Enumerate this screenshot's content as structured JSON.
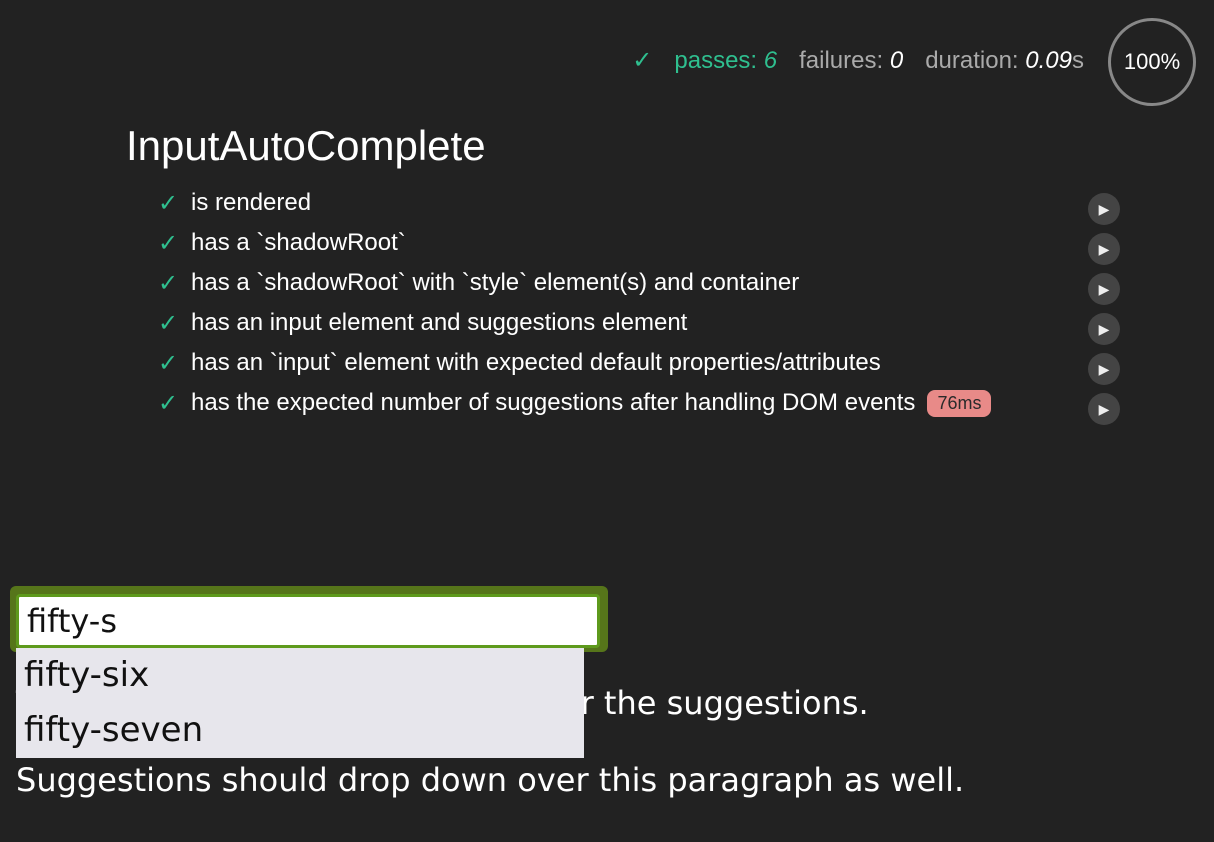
{
  "stats": {
    "check_glyph": "✓",
    "passes_label": "passes:",
    "passes_value": "6",
    "failures_label": "failures:",
    "failures_value": "0",
    "duration_label": "duration:",
    "duration_value": "0.09",
    "duration_unit": "s",
    "progress_text": "100%"
  },
  "suite": {
    "title": "InputAutoComplete",
    "tests": [
      {
        "label": "is rendered",
        "status": "passed"
      },
      {
        "label": "has a `shadowRoot`",
        "status": "passed"
      },
      {
        "label": "has a `shadowRoot` with `style` element(s) and container",
        "status": "passed"
      },
      {
        "label": "has an input element and suggestions element",
        "status": "passed"
      },
      {
        "label": "has an `input` element with expected default properties/attributes",
        "status": "passed"
      },
      {
        "label": "has the expected number of suggestions after handling DOM events",
        "status": "passed",
        "duration": "76ms"
      }
    ]
  },
  "fixture": {
    "input_value": "fifty-s",
    "suggestions": [
      "fifty-six",
      "fifty-seven"
    ],
    "paragraph_1": "This paragraph should render under the suggestions.",
    "paragraph_2": "Suggestions should drop down over this paragraph as well."
  },
  "colors": {
    "background": "#222222",
    "pass_green": "#2fbf8f",
    "duration_badge": "#e88a88",
    "input_focus_border": "#5e9a1c",
    "suggestions_bg": "#e7e6ec"
  },
  "icons": {
    "check": "check-icon",
    "replay": "play-icon"
  }
}
